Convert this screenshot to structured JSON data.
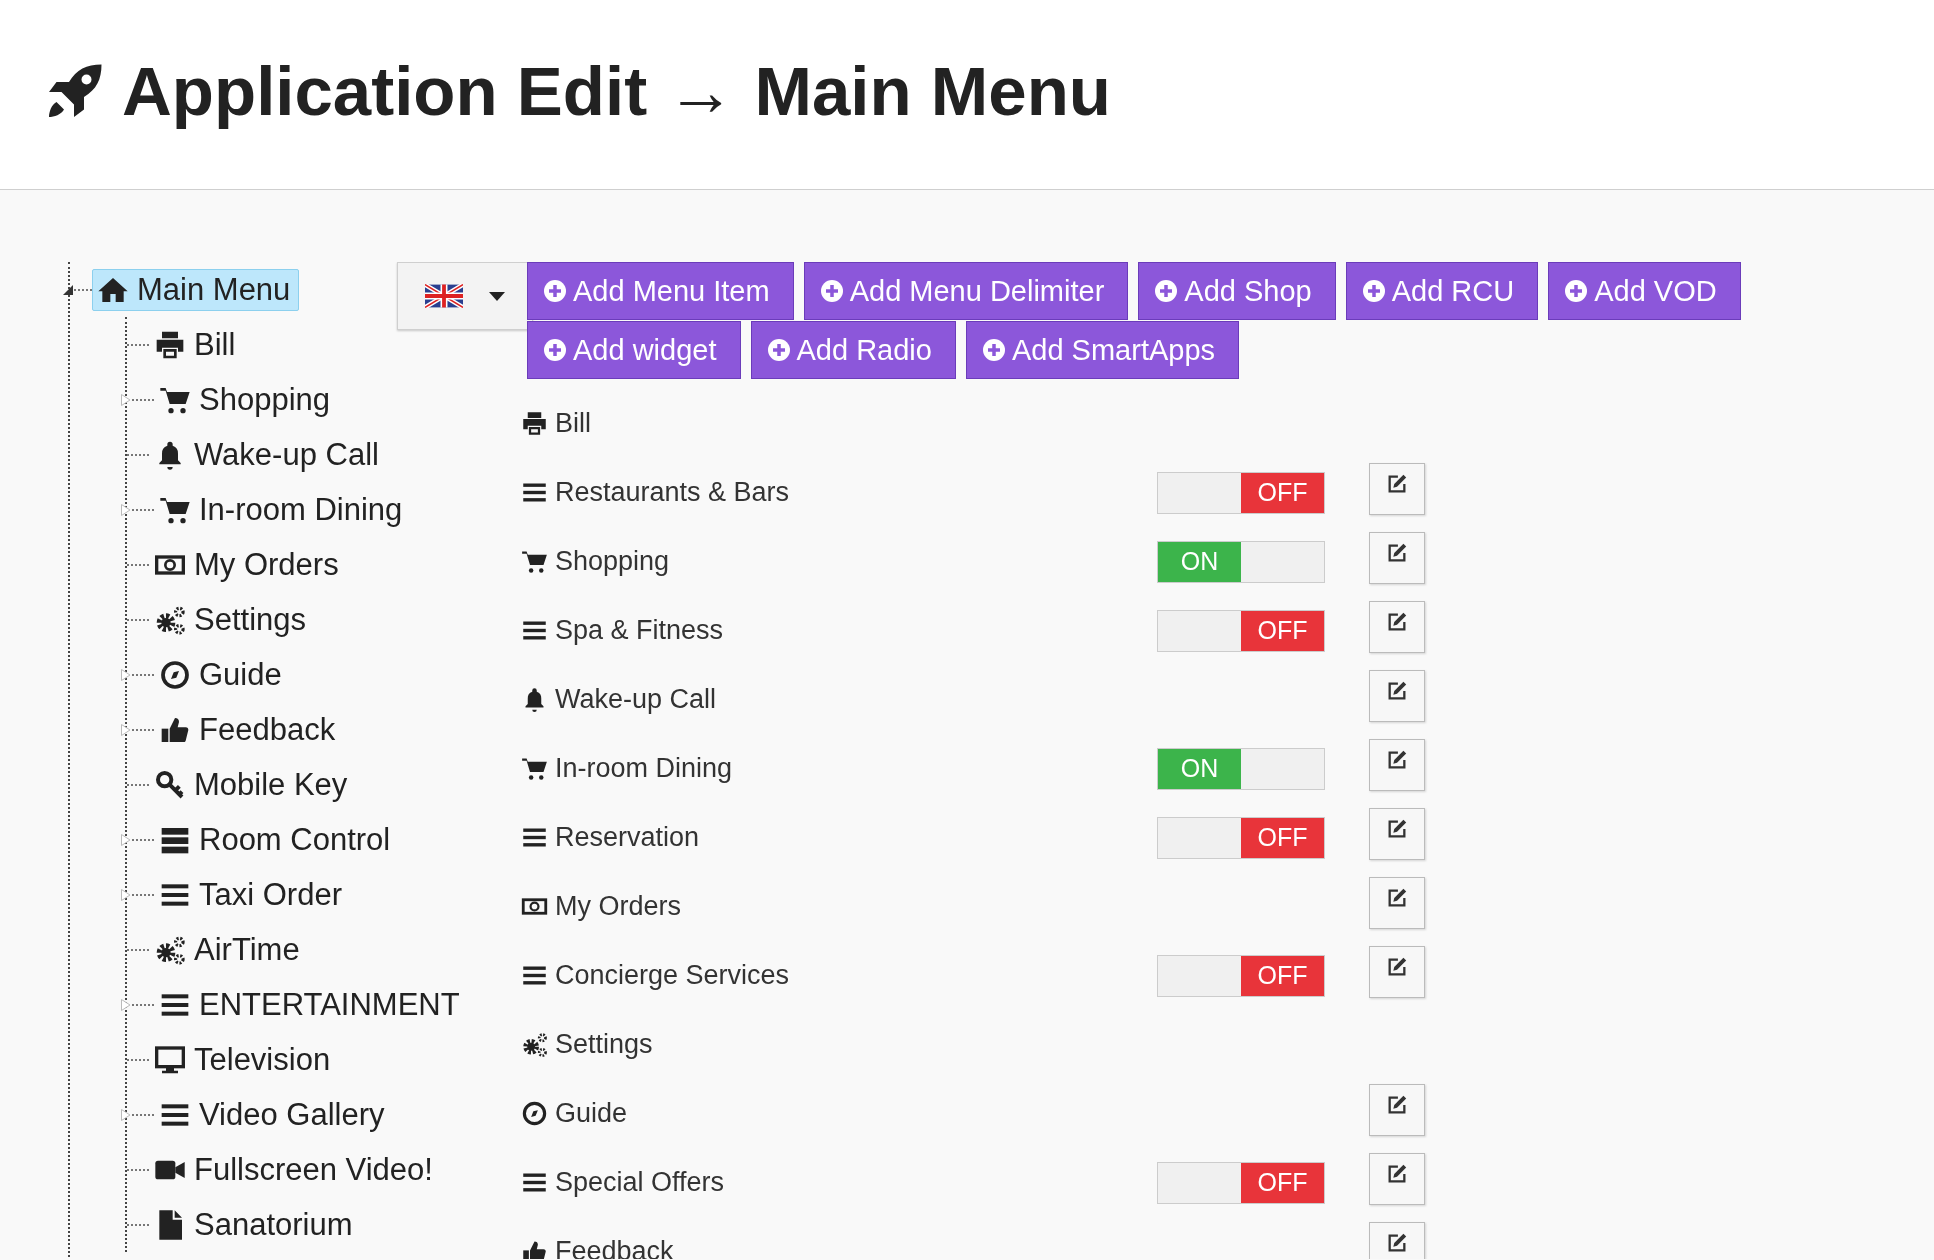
{
  "header": {
    "title": "Application Edit → Main Menu"
  },
  "tree": {
    "label": "Main Menu",
    "kind": "home",
    "expanded": true,
    "selected": true,
    "children": [
      {
        "label": "Bill",
        "kind": "printer",
        "selected": false
      },
      {
        "label": "Shopping",
        "kind": "cart",
        "expanded": false,
        "selected": false
      },
      {
        "label": "Wake-up Call",
        "kind": "bell",
        "selected": false
      },
      {
        "label": "In-room Dining",
        "kind": "cart",
        "expanded": false,
        "selected": false
      },
      {
        "label": "My Orders",
        "kind": "money",
        "selected": false
      },
      {
        "label": "Settings",
        "kind": "gears",
        "selected": false
      },
      {
        "label": "Guide",
        "kind": "compass",
        "expanded": false,
        "selected": false
      },
      {
        "label": "Feedback",
        "kind": "thumb",
        "expanded": false,
        "selected": false
      },
      {
        "label": "Mobile Key",
        "kind": "key",
        "selected": false
      },
      {
        "label": "Room Control",
        "kind": "server",
        "expanded": false,
        "selected": false
      },
      {
        "label": "Taxi Order",
        "kind": "lines",
        "expanded": false,
        "selected": false
      },
      {
        "label": "AirTime",
        "kind": "gears",
        "selected": false
      },
      {
        "label": "ENTERTAINMENT",
        "kind": "lines",
        "expanded": false,
        "selected": false
      },
      {
        "label": "Television",
        "kind": "monitor",
        "selected": false
      },
      {
        "label": "Video Gallery",
        "kind": "lines",
        "expanded": false,
        "selected": false
      },
      {
        "label": "Fullscreen Video!",
        "kind": "video",
        "selected": false
      },
      {
        "label": "Sanatorium",
        "kind": "file",
        "selected": false
      }
    ]
  },
  "add_buttons": [
    "Add Menu Item",
    "Add Menu Delimiter",
    "Add Shop",
    "Add RCU",
    "Add VOD",
    "Add widget",
    "Add Radio",
    "Add SmartApps"
  ],
  "items": [
    {
      "label": "Bill",
      "kind": "printer",
      "editable": false
    },
    {
      "label": "Restaurants & Bars",
      "kind": "lines",
      "toggle": {
        "on": false,
        "label": "OFF"
      },
      "editable": true
    },
    {
      "label": "Shopping",
      "kind": "cart",
      "toggle": {
        "on": true,
        "label": "ON"
      },
      "editable": true
    },
    {
      "label": "Spa & Fitness",
      "kind": "lines",
      "toggle": {
        "on": false,
        "label": "OFF"
      },
      "editable": true
    },
    {
      "label": "Wake-up Call",
      "kind": "bell",
      "editable": true
    },
    {
      "label": "In-room Dining",
      "kind": "cart",
      "toggle": {
        "on": true,
        "label": "ON"
      },
      "editable": true
    },
    {
      "label": "Reservation",
      "kind": "lines",
      "toggle": {
        "on": false,
        "label": "OFF"
      },
      "editable": true
    },
    {
      "label": "My Orders",
      "kind": "money",
      "editable": true
    },
    {
      "label": "Concierge Services",
      "kind": "lines",
      "toggle": {
        "on": false,
        "label": "OFF"
      },
      "editable": true
    },
    {
      "label": "Settings",
      "kind": "gears",
      "editable": false
    },
    {
      "label": "Guide",
      "kind": "compass",
      "editable": true
    },
    {
      "label": "Special Offers",
      "kind": "lines",
      "toggle": {
        "on": false,
        "label": "OFF"
      },
      "editable": true
    },
    {
      "label": "Feedback",
      "kind": "thumb",
      "editable": true
    }
  ]
}
